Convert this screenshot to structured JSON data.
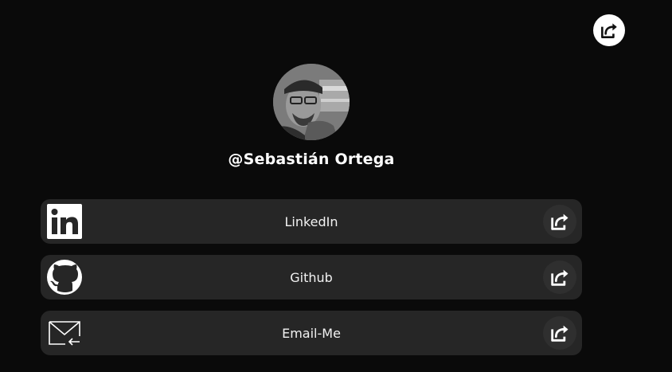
{
  "profile": {
    "username": "@Sebastián Ortega",
    "avatar_alt": "Profile photo"
  },
  "header": {
    "share_icon": "share-icon"
  },
  "links": [
    {
      "label": "LinkedIn",
      "icon": "linkedin-icon",
      "share_icon": "share-icon"
    },
    {
      "label": "Github",
      "icon": "github-icon",
      "share_icon": "share-icon"
    },
    {
      "label": "Email-Me",
      "icon": "email-icon",
      "share_icon": "share-icon"
    }
  ],
  "colors": {
    "background": "#0a0a0a",
    "card": "#262626",
    "text": "#ffffff"
  }
}
